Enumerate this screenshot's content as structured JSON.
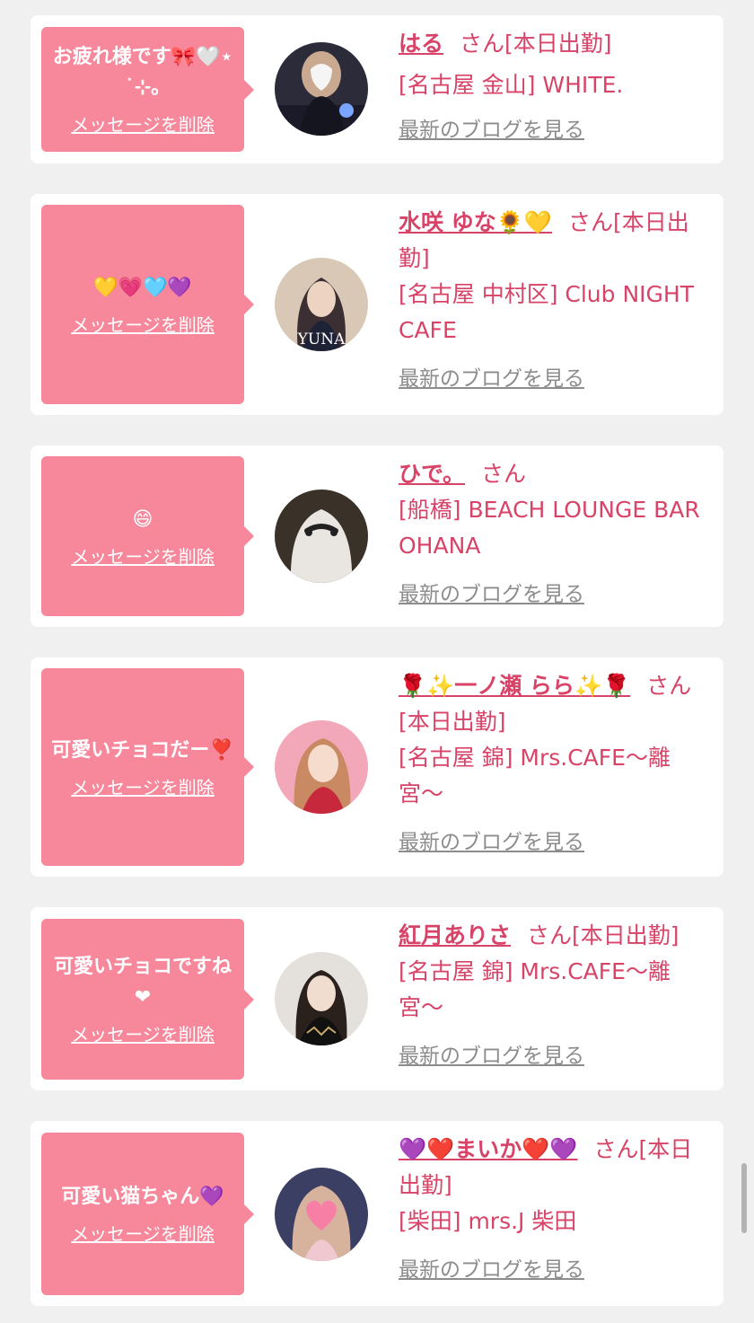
{
  "delete_label": "メッセージを削除",
  "blog_label": "最新のブログを見る",
  "colors": {
    "bubble": "#f7879a",
    "text_pink": "#d84368",
    "link_gray": "#8c8c8c",
    "background": "#f0f0f0"
  },
  "items": [
    {
      "message": "お疲れ様です🎀🤍⋆˙⊹｡",
      "name": "はる",
      "suffix": "さん[本日出勤]",
      "shop": "[名古屋 金山] WHITE.",
      "avatar_icon": "girl-photo-avatar"
    },
    {
      "message": "💛💗🩵💜",
      "name": "水咲 ゆな🌻💛",
      "suffix": "さん[本日出勤]",
      "shop": "[名古屋 中村区] Club NIGHT CAFE",
      "avatar_icon": "yuna-photo-avatar"
    },
    {
      "message": "😄",
      "name": "ひで。",
      "suffix": "さん",
      "shop": "[船橋] BEACH LOUNGE BAR OHANA",
      "avatar_icon": "ghost-costume-avatar"
    },
    {
      "message": "可愛いチョコだー❣️",
      "name": "🌹✨一ノ瀬 らら✨🌹",
      "suffix": "さん[本日出勤]",
      "shop": "[名古屋 錦] Mrs.CAFE〜離宮〜",
      "avatar_icon": "girl-photo-avatar"
    },
    {
      "message": "可愛いチョコですね❤",
      "name": "紅月ありさ",
      "suffix": "さん[本日出勤]",
      "shop": "[名古屋 錦] Mrs.CAFE〜離宮〜",
      "avatar_icon": "girl-photo-avatar"
    },
    {
      "message": "可愛い猫ちゃん💜",
      "name": "💜❤️まいか❤️💜",
      "suffix": "さん[本日出勤]",
      "shop": "[柴田] mrs.J 柴田",
      "avatar_icon": "heart-face-avatar"
    }
  ]
}
